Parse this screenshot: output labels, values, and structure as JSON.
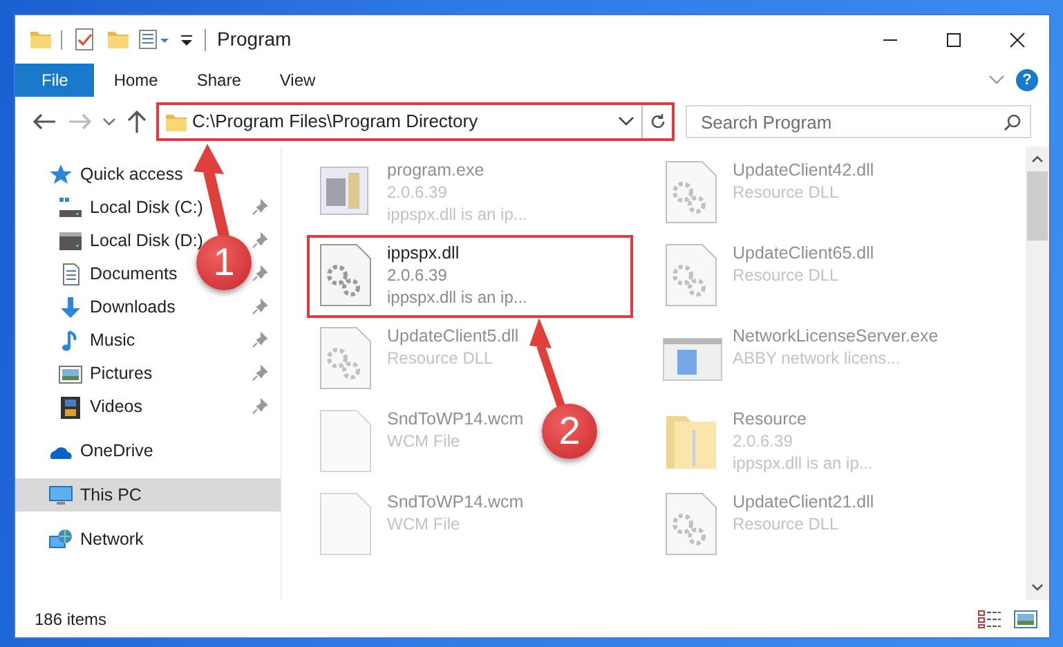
{
  "window": {
    "title": "Program"
  },
  "ribbon_tabs": [
    {
      "label": "File",
      "kind": "file"
    },
    {
      "label": "Home",
      "kind": "tab"
    },
    {
      "label": "Share",
      "kind": "tab"
    },
    {
      "label": "View",
      "kind": "tab"
    }
  ],
  "help": "?",
  "address": {
    "path": "C:\\Program Files\\Program Directory",
    "highlighted": true
  },
  "search": {
    "placeholder": "Search Program"
  },
  "sidebar": {
    "items": [
      {
        "label": "Quick access",
        "kind": "star",
        "selected": false,
        "children": [
          {
            "label": "Local Disk (C:)",
            "kind": "system",
            "pinned": true
          },
          {
            "label": "Local Disk (D:)",
            "kind": "drive",
            "pinned": true
          },
          {
            "label": "Documents",
            "kind": "documents",
            "pinned": true
          },
          {
            "label": "Downloads",
            "kind": "downloads",
            "pinned": true
          },
          {
            "label": "Music",
            "kind": "music",
            "pinned": true
          },
          {
            "label": "Pictures",
            "kind": "pictures",
            "pinned": true
          },
          {
            "label": "Videos",
            "kind": "videos",
            "pinned": true
          }
        ]
      },
      {
        "label": "OneDrive",
        "kind": "cloud",
        "selected": false
      },
      {
        "label": "This PC",
        "kind": "computer",
        "selected": true
      },
      {
        "label": "Network",
        "kind": "network",
        "selected": false
      }
    ]
  },
  "files": [
    {
      "name": "program.exe",
      "details": [
        "2.0.6.39",
        "ippspx.dll is an ip..."
      ],
      "kind": "exe",
      "highlighted": false
    },
    {
      "name": "UpdateClient42.dll",
      "details": [
        "Resource DLL"
      ],
      "kind": "dll",
      "highlighted": false
    },
    {
      "name": "ippspx.dll",
      "details": [
        "2.0.6.39",
        "ippspx.dll is an ip..."
      ],
      "kind": "dll",
      "highlighted": true
    },
    {
      "name": "UpdateClient65.dll",
      "details": [
        "Resource DLL"
      ],
      "kind": "dll",
      "highlighted": false
    },
    {
      "name": "UpdateClient5.dll",
      "details": [
        "Resource DLL"
      ],
      "kind": "dll",
      "highlighted": false
    },
    {
      "name": "NetworkLicenseServer.exe",
      "details": [
        "ABBY network licens..."
      ],
      "kind": "app",
      "highlighted": false
    },
    {
      "name": "SndToWP14.wcm",
      "details": [
        "WCM File"
      ],
      "kind": "file",
      "highlighted": false
    },
    {
      "name": "Resource",
      "details": [
        "2.0.6.39",
        "ippspx.dll is an ip..."
      ],
      "kind": "folder",
      "highlighted": false
    },
    {
      "name": "SndToWP14.wcm",
      "details": [
        "WCM File"
      ],
      "kind": "file",
      "highlighted": false
    },
    {
      "name": "UpdateClient21.dll",
      "details": [
        "Resource DLL"
      ],
      "kind": "dll",
      "highlighted": false
    }
  ],
  "status_bar": {
    "count": "186 items"
  },
  "callouts": [
    {
      "number": "1"
    },
    {
      "number": "2"
    }
  ]
}
